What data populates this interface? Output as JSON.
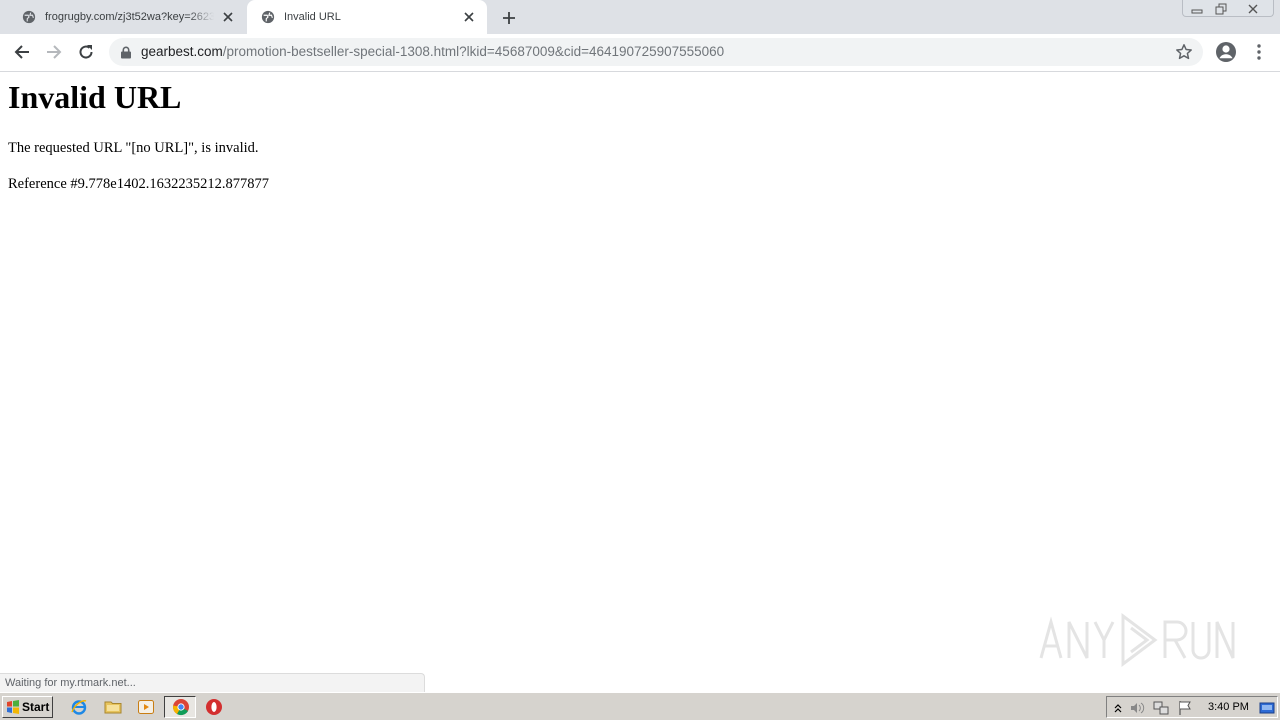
{
  "browser": {
    "tabs": [
      {
        "title": "frogrugby.com/zj3t52wa?key=2623…",
        "active": false
      },
      {
        "title": "Invalid URL",
        "active": true
      }
    ],
    "address": {
      "host": "gearbest.com",
      "path": "/promotion-bestseller-special-1308.html?lkid=45687009&cid=464190725907555060"
    },
    "status_text": "Waiting for my.rtmark.net..."
  },
  "page": {
    "heading": "Invalid URL",
    "message": "The requested URL \"[no URL]\", is invalid.",
    "reference": "Reference #9.778e1402.1632235212.877877"
  },
  "watermark": "ANY RUN",
  "taskbar": {
    "start_label": "Start",
    "clock": "3:40 PM"
  },
  "icons": [
    "globe-icon",
    "close-icon",
    "plus-icon",
    "back-icon",
    "forward-icon",
    "reload-icon",
    "lock-icon",
    "star-icon",
    "profile-icon",
    "kebab-menu-icon",
    "windows-logo-icon",
    "ie-icon",
    "folder-icon",
    "media-player-icon",
    "chrome-icon",
    "opera-icon",
    "chevron-up-icon",
    "speaker-icon",
    "network-icon",
    "flag-icon",
    "show-desktop-icon"
  ]
}
